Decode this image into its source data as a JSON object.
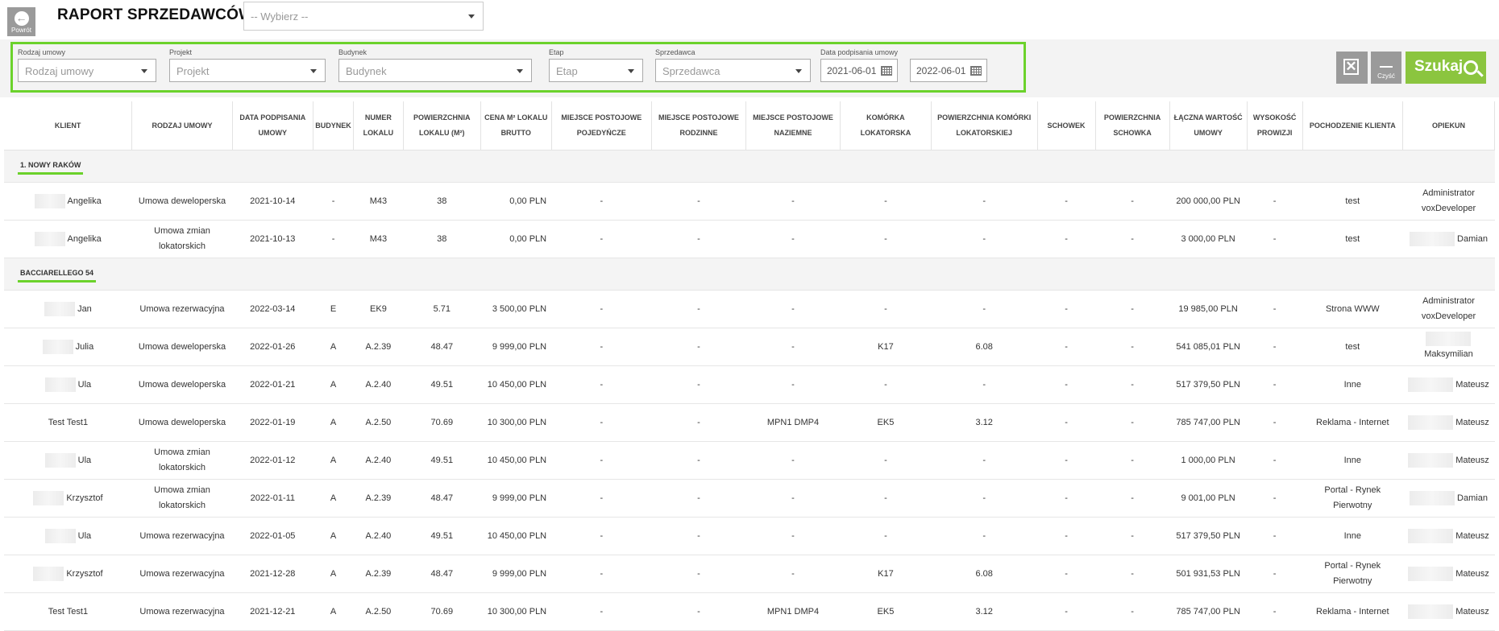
{
  "header": {
    "back_label": "Powrót",
    "title": "RAPORT SPRZEDAWCÓW",
    "seller_select": "-- Wybierz --"
  },
  "filters": {
    "contract_type": {
      "label": "Rodzaj umowy",
      "placeholder": "Rodzaj umowy"
    },
    "project": {
      "label": "Projekt",
      "placeholder": "Projekt"
    },
    "building": {
      "label": "Budynek",
      "placeholder": "Budynek"
    },
    "stage": {
      "label": "Etap",
      "placeholder": "Etap"
    },
    "seller": {
      "label": "Sprzedawca",
      "placeholder": "Sprzedawca"
    },
    "date": {
      "label": "Data podpisania umowy",
      "from": "2021-06-01",
      "to": "2022-06-01"
    }
  },
  "actions": {
    "clear_label": "Czyść",
    "search_label": "Szukaj"
  },
  "table": {
    "columns": [
      "KLIENT",
      "RODZAJ UMOWY",
      "DATA PODPISANIA UMOWY",
      "BUDYNEK",
      "NUMER LOKALU",
      "POWIERZCHNIA LOKALU (M²)",
      "CENA M² LOKALU BRUTTO",
      "MIEJSCE POSTOJOWE POJEDYŃCZE",
      "MIEJSCE POSTOJOWE RODZINNE",
      "MIEJSCE POSTOJOWE NAZIEMNE",
      "KOMÓRKA LOKATORSKA",
      "POWIERZCHNIA KOMÓRKI LOKATORSKIEJ",
      "SCHOWEK",
      "POWIERZCHNIA SCHOWKA",
      "ŁĄCZNA WARTOŚĆ UMOWY",
      "WYSOKOŚĆ PROWIZJI",
      "POCHODZENIE KLIENTA",
      "OPIEKUN"
    ],
    "groups": [
      {
        "name": "1. NOWY RAKÓW",
        "rows": [
          {
            "client": "Angelika",
            "contract": "Umowa deweloperska",
            "date": "2021-10-14",
            "building": "-",
            "unit": "M43",
            "area": "38",
            "price": "0,00 PLN",
            "p_single": "-",
            "p_family": "-",
            "p_ground": "-",
            "storage": "-",
            "storage_area": "-",
            "locker": "-",
            "locker_area": "-",
            "total": "200 000,00 PLN",
            "commission": "-",
            "origin": "test",
            "owner": "Administrator voxDeveloper"
          },
          {
            "client": "Angelika",
            "contract": "Umowa zmian lokatorskich",
            "date": "2021-10-13",
            "building": "-",
            "unit": "M43",
            "area": "38",
            "price": "0,00 PLN",
            "p_single": "-",
            "p_family": "-",
            "p_ground": "-",
            "storage": "-",
            "storage_area": "-",
            "locker": "-",
            "locker_area": "-",
            "total": "3 000,00 PLN",
            "commission": "-",
            "origin": "test",
            "owner": "Damian"
          }
        ]
      },
      {
        "name": "BACCIARELLEGO 54",
        "rows": [
          {
            "client": "Jan",
            "contract": "Umowa rezerwacyjna",
            "date": "2022-03-14",
            "building": "E",
            "unit": "EK9",
            "area": "5.71",
            "price": "3 500,00 PLN",
            "p_single": "-",
            "p_family": "-",
            "p_ground": "-",
            "storage": "-",
            "storage_area": "-",
            "locker": "-",
            "locker_area": "-",
            "total": "19 985,00 PLN",
            "commission": "-",
            "origin": "Strona WWW",
            "owner": "Administrator voxDeveloper"
          },
          {
            "client": "Julia",
            "contract": "Umowa deweloperska",
            "date": "2022-01-26",
            "building": "A",
            "unit": "A.2.39",
            "area": "48.47",
            "price": "9 999,00 PLN",
            "p_single": "-",
            "p_family": "-",
            "p_ground": "-",
            "storage": "K17",
            "storage_area": "6.08",
            "locker": "-",
            "locker_area": "-",
            "total": "541 085,01 PLN",
            "commission": "-",
            "origin": "test",
            "owner": "Maksymilian"
          },
          {
            "client": "Ula",
            "contract": "Umowa deweloperska",
            "date": "2022-01-21",
            "building": "A",
            "unit": "A.2.40",
            "area": "49.51",
            "price": "10 450,00 PLN",
            "p_single": "-",
            "p_family": "-",
            "p_ground": "-",
            "storage": "-",
            "storage_area": "-",
            "locker": "-",
            "locker_area": "-",
            "total": "517 379,50 PLN",
            "commission": "-",
            "origin": "Inne",
            "owner": "Mateusz"
          },
          {
            "client": "Test Test1",
            "contract": "Umowa deweloperska",
            "date": "2022-01-19",
            "building": "A",
            "unit": "A.2.50",
            "area": "70.69",
            "price": "10 300,00 PLN",
            "p_single": "-",
            "p_family": "-",
            "p_ground": "MPN1 DMP4",
            "storage": "EK5",
            "storage_area": "3.12",
            "locker": "-",
            "locker_area": "-",
            "total": "785 747,00 PLN",
            "commission": "-",
            "origin": "Reklama - Internet",
            "owner": "Mateusz"
          },
          {
            "client": "Ula",
            "contract": "Umowa zmian lokatorskich",
            "date": "2022-01-12",
            "building": "A",
            "unit": "A.2.40",
            "area": "49.51",
            "price": "10 450,00 PLN",
            "p_single": "-",
            "p_family": "-",
            "p_ground": "-",
            "storage": "-",
            "storage_area": "-",
            "locker": "-",
            "locker_area": "-",
            "total": "1 000,00 PLN",
            "commission": "-",
            "origin": "Inne",
            "owner": "Mateusz"
          },
          {
            "client": "Krzysztof",
            "contract": "Umowa zmian lokatorskich",
            "date": "2022-01-11",
            "building": "A",
            "unit": "A.2.39",
            "area": "48.47",
            "price": "9 999,00 PLN",
            "p_single": "-",
            "p_family": "-",
            "p_ground": "-",
            "storage": "-",
            "storage_area": "-",
            "locker": "-",
            "locker_area": "-",
            "total": "9 001,00 PLN",
            "commission": "-",
            "origin": "Portal - Rynek Pierwotny",
            "owner": "Damian"
          },
          {
            "client": "Ula",
            "contract": "Umowa rezerwacyjna",
            "date": "2022-01-05",
            "building": "A",
            "unit": "A.2.40",
            "area": "49.51",
            "price": "10 450,00 PLN",
            "p_single": "-",
            "p_family": "-",
            "p_ground": "-",
            "storage": "-",
            "storage_area": "-",
            "locker": "-",
            "locker_area": "-",
            "total": "517 379,50 PLN",
            "commission": "-",
            "origin": "Inne",
            "owner": "Mateusz"
          },
          {
            "client": "Krzysztof",
            "contract": "Umowa rezerwacyjna",
            "date": "2021-12-28",
            "building": "A",
            "unit": "A.2.39",
            "area": "48.47",
            "price": "9 999,00 PLN",
            "p_single": "-",
            "p_family": "-",
            "p_ground": "-",
            "storage": "K17",
            "storage_area": "6.08",
            "locker": "-",
            "locker_area": "-",
            "total": "501 931,53 PLN",
            "commission": "-",
            "origin": "Portal - Rynek Pierwotny",
            "owner": "Mateusz"
          },
          {
            "client": "Test Test1",
            "contract": "Umowa rezerwacyjna",
            "date": "2021-12-21",
            "building": "A",
            "unit": "A.2.50",
            "area": "70.69",
            "price": "10 300,00 PLN",
            "p_single": "-",
            "p_family": "-",
            "p_ground": "MPN1 DMP4",
            "storage": "EK5",
            "storage_area": "3.12",
            "locker": "-",
            "locker_area": "-",
            "total": "785 747,00 PLN",
            "commission": "-",
            "origin": "Reklama - Internet",
            "owner": "Mateusz"
          }
        ]
      }
    ]
  },
  "colors": {
    "accent_green": "#6bd22b",
    "search_green": "#8bc53f",
    "button_gray": "#9a9a9a"
  }
}
